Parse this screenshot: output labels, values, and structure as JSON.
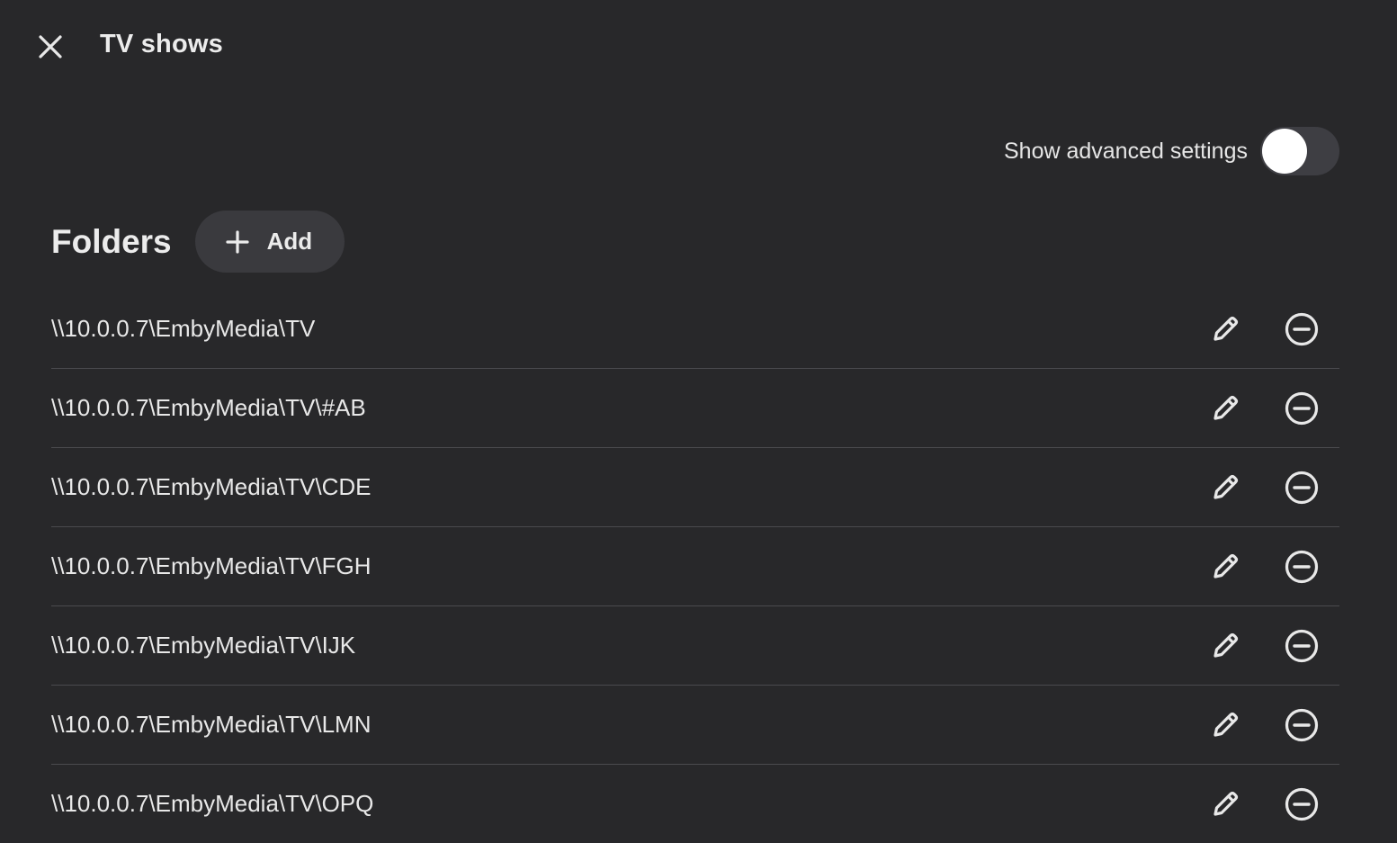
{
  "header": {
    "title": "TV shows",
    "close_icon": "close-icon"
  },
  "advanced": {
    "label": "Show advanced settings",
    "enabled": false
  },
  "folders": {
    "title": "Folders",
    "add_label": "Add",
    "add_icon": "plus-icon",
    "items": [
      {
        "path": "\\\\10.0.0.7\\EmbyMedia\\TV"
      },
      {
        "path": "\\\\10.0.0.7\\EmbyMedia\\TV\\#AB"
      },
      {
        "path": "\\\\10.0.0.7\\EmbyMedia\\TV\\CDE"
      },
      {
        "path": "\\\\10.0.0.7\\EmbyMedia\\TV\\FGH"
      },
      {
        "path": "\\\\10.0.0.7\\EmbyMedia\\TV\\IJK"
      },
      {
        "path": "\\\\10.0.0.7\\EmbyMedia\\TV\\LMN"
      },
      {
        "path": "\\\\10.0.0.7\\EmbyMedia\\TV\\OPQ"
      }
    ],
    "edit_icon": "pencil-icon",
    "remove_icon": "remove-circle-icon"
  },
  "colors": {
    "background": "#28282a",
    "button_bg": "#3a3a3e",
    "toggle_track": "#3e3e43",
    "text": "#e8e8e8"
  }
}
